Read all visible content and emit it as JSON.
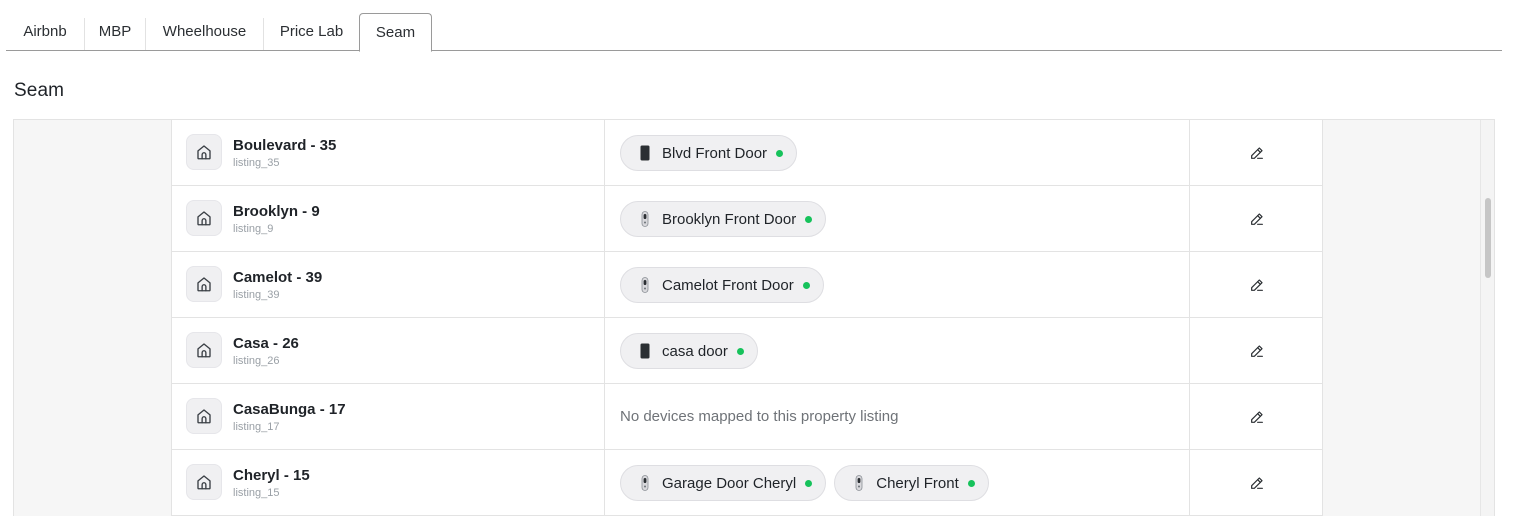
{
  "tabs": [
    {
      "label": "Airbnb",
      "active": false
    },
    {
      "label": "MBP",
      "active": false
    },
    {
      "label": "Wheelhouse",
      "active": false
    },
    {
      "label": "Price Lab",
      "active": false
    },
    {
      "label": "Seam",
      "active": true
    }
  ],
  "section": {
    "title": "Seam"
  },
  "colors": {
    "status_online": "#16c25b",
    "tab_border": "#9a9a9a"
  },
  "rows": [
    {
      "name": "Boulevard - 35",
      "id": "listing_35",
      "devices": [
        {
          "label": "Blvd Front Door",
          "icon": "keypad-lock-icon",
          "status": "online"
        }
      ],
      "empty": ""
    },
    {
      "name": "Brooklyn - 9",
      "id": "listing_9",
      "devices": [
        {
          "label": "Brooklyn Front Door",
          "icon": "smart-lock-icon",
          "status": "online"
        }
      ],
      "empty": ""
    },
    {
      "name": "Camelot - 39",
      "id": "listing_39",
      "devices": [
        {
          "label": "Camelot Front Door",
          "icon": "smart-lock-icon",
          "status": "online"
        }
      ],
      "empty": ""
    },
    {
      "name": "Casa - 26",
      "id": "listing_26",
      "devices": [
        {
          "label": "casa door",
          "icon": "keypad-lock-icon",
          "status": "online"
        }
      ],
      "empty": ""
    },
    {
      "name": "CasaBunga - 17",
      "id": "listing_17",
      "devices": [],
      "empty": "No devices mapped to this property listing"
    },
    {
      "name": "Cheryl - 15",
      "id": "listing_15",
      "devices": [
        {
          "label": "Garage Door Cheryl",
          "icon": "smart-lock-icon",
          "status": "online"
        },
        {
          "label": "Cheryl Front",
          "icon": "smart-lock-icon",
          "status": "online"
        }
      ],
      "empty": ""
    }
  ]
}
